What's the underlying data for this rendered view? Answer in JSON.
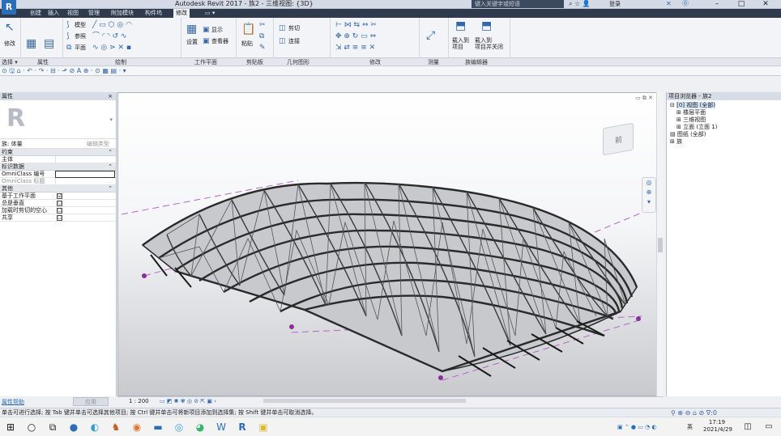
{
  "app": {
    "logo": "R",
    "title": "Autodesk Revit 2017 -    族2 - 三维视图: {3D}",
    "search_placeholder": "键入关键字或短语",
    "login": "登录",
    "win_min": "–",
    "win_max": "□",
    "win_close": "✕"
  },
  "tabs": [
    "创建",
    "插入",
    "视图",
    "管理",
    "附加模块",
    "构件坞",
    "修改",
    "▭ ▾"
  ],
  "active_tab_index": 6,
  "ribbon": {
    "modify_label": "修改",
    "model_line": "模型",
    "ref_line": "参照",
    "plane": "平面",
    "set": "设置",
    "show": "显示",
    "viewer": "查看器",
    "paste": "粘贴",
    "cut": "剪切",
    "join": "连接",
    "load_into_project": "载入到\n项目",
    "load_close": "载入到\n项目并关闭"
  },
  "panels": [
    "选择 ▾",
    "属性",
    "绘制",
    "工作平面",
    "剪贴板",
    "几何图形",
    "修改",
    "测量",
    "族编辑器"
  ],
  "properties": {
    "title": "属性",
    "close": "×",
    "type_name": "族: 体量",
    "edit_type": "编辑类型",
    "sections": [
      {
        "name": "约束",
        "rows": [
          {
            "k": "主体",
            "v": ""
          }
        ]
      },
      {
        "name": "标识数据",
        "rows": [
          {
            "k": "OmniClass 编号",
            "v": ""
          },
          {
            "k": "OmniClass 标题",
            "v": ""
          }
        ]
      },
      {
        "name": "其他",
        "rows": [
          {
            "k": "基于工作平面",
            "v": "☑"
          },
          {
            "k": "总是垂直",
            "v": "☐"
          },
          {
            "k": "加载时剪切的空心",
            "v": "☐"
          },
          {
            "k": "共享",
            "v": "☐"
          }
        ]
      }
    ],
    "help_link": "属性帮助",
    "apply": "应用"
  },
  "viewport": {
    "scale": "1 : 200",
    "viewcube_label": "前",
    "canvas_controls": "▭ ⧉ ✕"
  },
  "project_browser": {
    "title": "项目浏览器 - 族2",
    "items": [
      {
        "label": "[0] 视图 (全部)",
        "level": 0,
        "selected": true
      },
      {
        "label": "楼层平面",
        "level": 1
      },
      {
        "label": "三维视图",
        "level": 1
      },
      {
        "label": "立面 (立面 1)",
        "level": 1
      },
      {
        "label": "图纸 (全部)",
        "level": 0
      },
      {
        "label": "族",
        "level": 0
      }
    ]
  },
  "status": {
    "text": "单击可进行选择; 按 Tab 键并单击可选择其他项目; 按 Ctrl 键并单击可将新项目添加到选择集; 按 Shift 键并单击可取消选择。",
    "right": ":0"
  },
  "taskbar": {
    "lang": "英",
    "time": "17:19",
    "date": "2021/4/29"
  },
  "colors": {
    "accent": "#2c6db5",
    "ribbon_dark": "#2f3b4c",
    "grid_line": "#b565c8",
    "truss": "#2a2a2a"
  }
}
